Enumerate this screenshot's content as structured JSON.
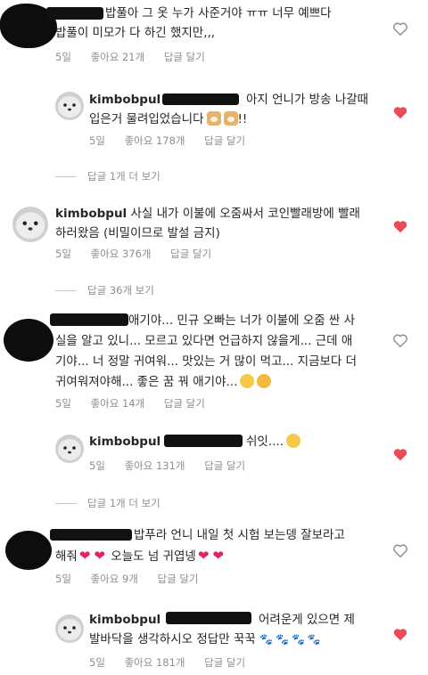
{
  "emoji": {
    "dog": "dog-face-emoji",
    "heart": "red-heart-emoji",
    "shush": "shushing-face-emoji",
    "cry": "crying-face-emoji",
    "love": "smiling-face-with-hearts-emoji",
    "paws": "paw-prints-emoji"
  },
  "colors": {
    "heart_outline": "#8e8e8e",
    "heart_liked": "#ed4956",
    "meta_gray": "#8e8e8e"
  },
  "comments": [
    {
      "line1": "밥풀아 그 옷 누가 사준거야 ㅠㅠ 너무 예쁘다",
      "line2": "밥풀이 미모가 다 하긴 했지만,,,",
      "time": "5일",
      "likes": "좋아요 21개",
      "reply": "답글 달기",
      "view_replies": "답글 1개 더 보기",
      "reply_item": {
        "user": "kimbobpul",
        "line1": "아지 언니가 방송 나갈때",
        "line2": "입은거 물려입었습니다",
        "line2_tail": "!!",
        "time": "5일",
        "likes": "좋아요 178개",
        "reply": "답글 달기"
      }
    },
    {
      "user": "kimbobpul",
      "line1": "사실 내가 이불에 오줌싸서 코인빨래방에 빨래",
      "line2": "하러왔음 (비밀이므로 발설 금지)",
      "time": "5일",
      "likes": "좋아요 376개",
      "reply": "답글 달기",
      "view_replies": "답글 36개 보기"
    },
    {
      "line1": "애기야... 민규 오빠는 너가 이불에 오줌 싼 사",
      "line2": "실을 알고 있니... 모르고 있다면 언급하지 않을게... 근데 애",
      "line3": "기야... 너 정말 귀여워... 맛있는 거 많이 먹고... 지금보다 더",
      "line4": "귀여워져야해... 좋은 꿈 꿔 애기야...",
      "time": "5일",
      "likes": "좋아요 14개",
      "reply": "답글 달기",
      "view_replies": "답글 1개 더 보기",
      "reply_item": {
        "user": "kimbobpul",
        "text": "쉬잇....",
        "time": "5일",
        "likes": "좋아요 131개",
        "reply": "답글 달기"
      }
    },
    {
      "line1": "밥푸라 언니 내일 첫 시험 보는뎅 잘보라고",
      "line2a": "해줘",
      "line2b": "오늘도 넘 귀엽넹",
      "time": "5일",
      "likes": "좋아요 9개",
      "reply": "답글 달기",
      "reply_item": {
        "user": "kimbobpul",
        "line1": "어려운게 있으면 제",
        "line2": "발바닥을 생각하시오 정답만 꾹꾹",
        "time": "5일",
        "likes": "좋아요 181개",
        "reply": "답글 달기"
      }
    }
  ]
}
